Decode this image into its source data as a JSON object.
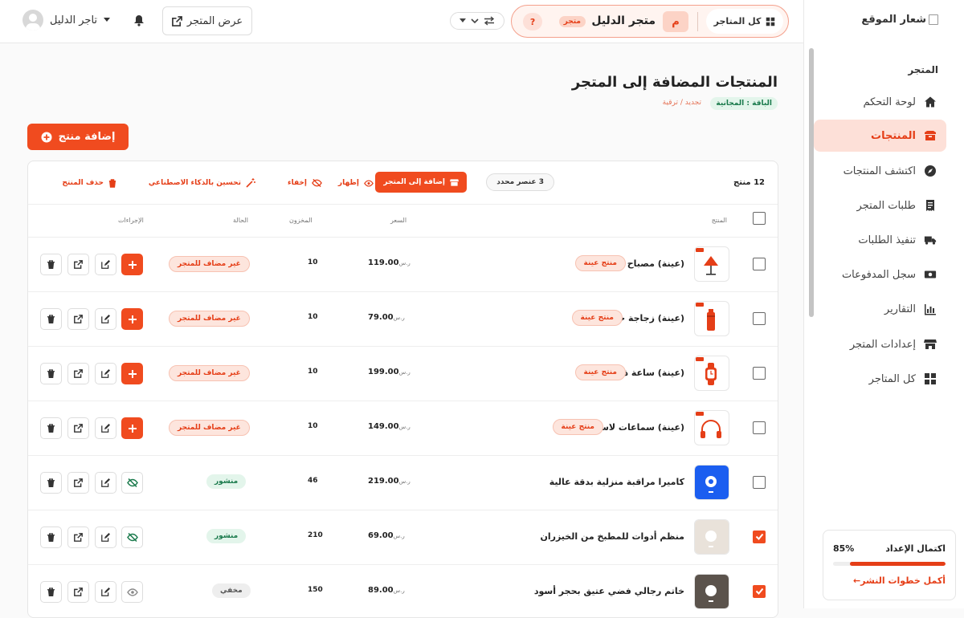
{
  "sidebar": {
    "logo_text": "شعار الموقع",
    "section_label": "المتجر",
    "items": [
      {
        "label": "لوحة التحكم",
        "icon": "home-icon"
      },
      {
        "label": "المنتجات",
        "icon": "box-icon",
        "active": true
      },
      {
        "label": "اكتشف المنتجات",
        "icon": "compass-icon"
      },
      {
        "label": "طلبات المتجر",
        "icon": "receipt-icon"
      },
      {
        "label": "تنفيذ الطلبات",
        "icon": "truck-icon"
      },
      {
        "label": "سجل المدفوعات",
        "icon": "money-icon"
      },
      {
        "label": "التقارير",
        "icon": "bar-chart-icon"
      },
      {
        "label": "إعدادات المتجر",
        "icon": "store-icon"
      },
      {
        "label": "كل المتاجر",
        "icon": "grid-icon"
      }
    ],
    "setup": {
      "title": "اكتمال الإعداد",
      "percent": "85%",
      "progress": 0.85,
      "link": "أكمل خطوات النشر←"
    }
  },
  "topbar": {
    "all_stores": "كل المتاجر",
    "store_initial": "م",
    "store_name": "متجر الدليل",
    "store_badge": "متجر",
    "help": "?",
    "view_store": "عرض المتجر",
    "user_name": "تاجر الدليل"
  },
  "page": {
    "title": "المنتجات المضافة إلى المتجر",
    "plan_badge": "الباقة : المجانية",
    "plan_links": "تجديد / ترقية",
    "add_button": "إضافة منتج"
  },
  "bulk": {
    "count": "12 منتج",
    "selected": "3 عنصر محدد",
    "add_to_store": "إضافة إلى المتجر",
    "show": "إظهار",
    "hide": "إخفاء",
    "ai_improve": "تحسين بالذكاء الاصطناعي",
    "delete": "حذف المنتج"
  },
  "table": {
    "headers": {
      "product": "المنتج",
      "price": "السعر",
      "stock": "المخزون",
      "status": "الحالة",
      "actions": "الإجراءات"
    },
    "currency": "ر.س",
    "sample_label": "منتج عينة",
    "rows": [
      {
        "name": "(عينة) مصباح مكتب",
        "price": "119.00",
        "stock": "10",
        "status": "غير مضاف للمتجر",
        "status_type": "notadded",
        "sample": true,
        "checked": false,
        "thumb": "lamp-icon"
      },
      {
        "name": "(عينة) زجاجة حرارية",
        "price": "79.00",
        "stock": "10",
        "status": "غير مضاف للمتجر",
        "status_type": "notadded",
        "sample": true,
        "checked": false,
        "thumb": "bottle-icon"
      },
      {
        "name": "(عينة) ساعة ذكية",
        "price": "199.00",
        "stock": "10",
        "status": "غير مضاف للمتجر",
        "status_type": "notadded",
        "sample": true,
        "checked": false,
        "thumb": "watch-icon"
      },
      {
        "name": "(عينة) سماعات لاسلكية",
        "price": "149.00",
        "stock": "10",
        "status": "غير مضاف للمتجر",
        "status_type": "notadded",
        "sample": true,
        "checked": false,
        "thumb": "headphones-icon"
      },
      {
        "name": "كاميرا مراقبة منزلية بدقة عالية",
        "price": "219.00",
        "stock": "46",
        "status": "منشور",
        "status_type": "published",
        "sample": false,
        "checked": false,
        "thumb": "camera-icon"
      },
      {
        "name": "منظم أدوات للمطبخ من الخيزران",
        "price": "69.00",
        "stock": "210",
        "status": "منشور",
        "status_type": "published",
        "sample": false,
        "checked": true,
        "thumb": "organizer-icon"
      },
      {
        "name": "خاتم رجالي فضي عتيق بحجر أسود",
        "price": "89.00",
        "stock": "150",
        "status": "مخفي",
        "status_type": "hidden",
        "sample": false,
        "checked": true,
        "thumb": "ring-icon"
      }
    ]
  },
  "colors": {
    "accent": "#f04b1f",
    "accent_soft": "#fde0d8",
    "success": "#1a7a4c"
  }
}
